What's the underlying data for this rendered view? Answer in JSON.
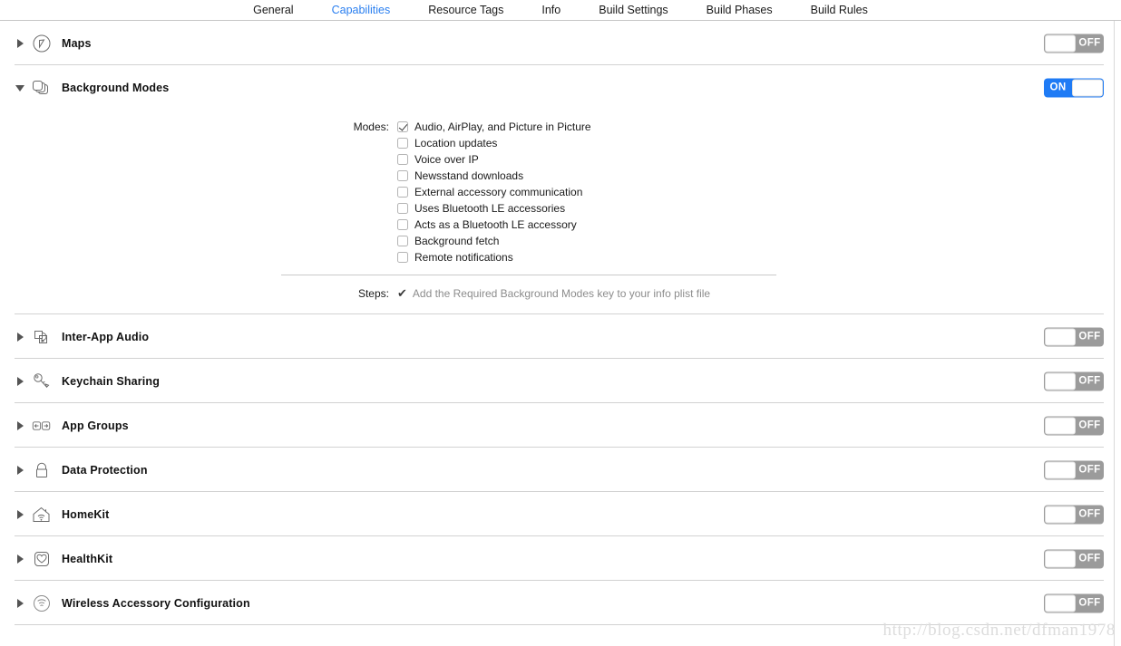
{
  "tabs": [
    {
      "label": "General",
      "active": false
    },
    {
      "label": "Capabilities",
      "active": true
    },
    {
      "label": "Resource Tags",
      "active": false
    },
    {
      "label": "Info",
      "active": false
    },
    {
      "label": "Build Settings",
      "active": false
    },
    {
      "label": "Build Phases",
      "active": false
    },
    {
      "label": "Build Rules",
      "active": false
    }
  ],
  "colors": {
    "active_tab": "#2a7ff0",
    "toggle_on": "#1f7bf5",
    "toggle_off": "#9b9b9b",
    "separator": "#d2d2d2",
    "muted_text": "#8c8c8c"
  },
  "capabilities": [
    {
      "title": "Maps",
      "icon": "maps-icon",
      "expanded": false,
      "toggle": "OFF"
    },
    {
      "title": "Background Modes",
      "icon": "background-modes-icon",
      "expanded": true,
      "toggle": "ON"
    },
    {
      "title": "Inter-App Audio",
      "icon": "inter-app-audio-icon",
      "expanded": false,
      "toggle": "OFF"
    },
    {
      "title": "Keychain Sharing",
      "icon": "keychain-sharing-icon",
      "expanded": false,
      "toggle": "OFF"
    },
    {
      "title": "App Groups",
      "icon": "app-groups-icon",
      "expanded": false,
      "toggle": "OFF"
    },
    {
      "title": "Data Protection",
      "icon": "data-protection-icon",
      "expanded": false,
      "toggle": "OFF"
    },
    {
      "title": "HomeKit",
      "icon": "homekit-icon",
      "expanded": false,
      "toggle": "OFF"
    },
    {
      "title": "HealthKit",
      "icon": "healthkit-icon",
      "expanded": false,
      "toggle": "OFF"
    },
    {
      "title": "Wireless Accessory Configuration",
      "icon": "wireless-accessory-icon",
      "expanded": false,
      "toggle": "OFF"
    }
  ],
  "background_modes": {
    "modes_label": "Modes:",
    "modes": [
      {
        "label": "Audio, AirPlay, and Picture in Picture",
        "checked": true
      },
      {
        "label": "Location updates",
        "checked": false
      },
      {
        "label": "Voice over IP",
        "checked": false
      },
      {
        "label": "Newsstand downloads",
        "checked": false
      },
      {
        "label": "External accessory communication",
        "checked": false
      },
      {
        "label": "Uses Bluetooth LE accessories",
        "checked": false
      },
      {
        "label": "Acts as a Bluetooth LE accessory",
        "checked": false
      },
      {
        "label": "Background fetch",
        "checked": false
      },
      {
        "label": "Remote notifications",
        "checked": false
      }
    ],
    "steps_label": "Steps:",
    "steps_check": "✔",
    "steps_text": "Add the Required Background Modes key to your info plist file"
  },
  "watermark": "http://blog.csdn.net/dfman1978"
}
